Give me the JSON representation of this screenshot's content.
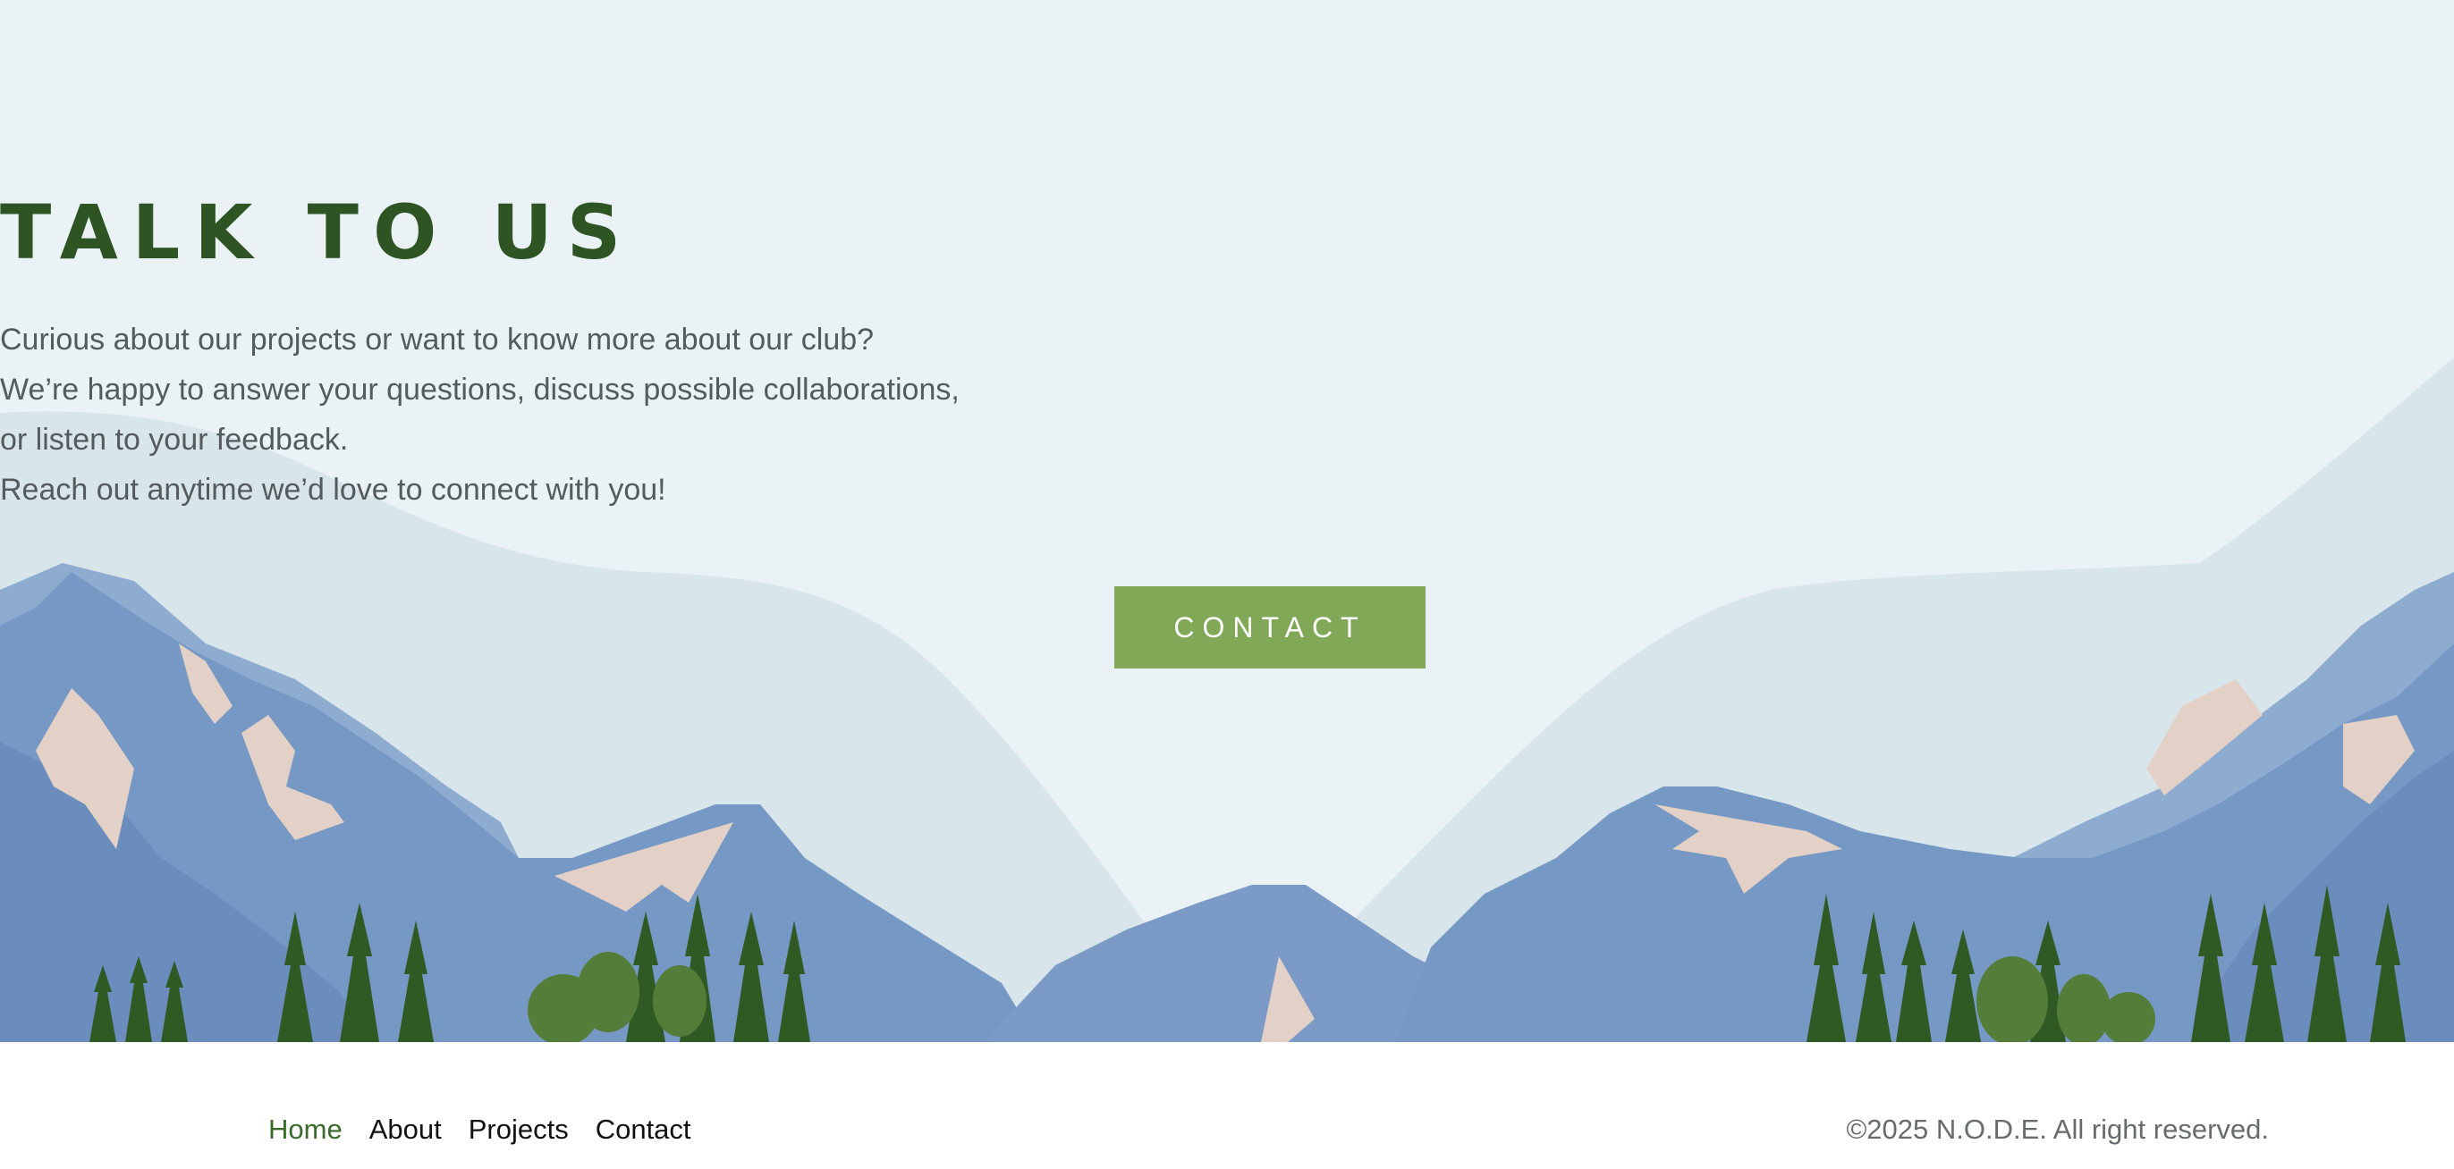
{
  "hero": {
    "title": "TALK TO US",
    "lines": [
      "Curious about our projects or want to know more about our club?",
      "We’re happy to answer your questions, discuss possible collaborations,",
      "or listen to your feedback.",
      "Reach out anytime we’d love to connect with you!"
    ],
    "button_label": "CONTACT"
  },
  "footer": {
    "nav": [
      {
        "label": "Home",
        "active": true
      },
      {
        "label": "About",
        "active": false
      },
      {
        "label": "Projects",
        "active": false
      },
      {
        "label": "Contact",
        "active": false
      }
    ],
    "copyright": "©2025 N.O.D.E. All right reserved."
  },
  "colors": {
    "sky": "#eaf2f5",
    "title_green": "#2e5424",
    "button_green": "#80a856",
    "mountain_blue": "#7598c4",
    "snow": "#e3d0c6",
    "tree_green": "#2f5a23"
  }
}
